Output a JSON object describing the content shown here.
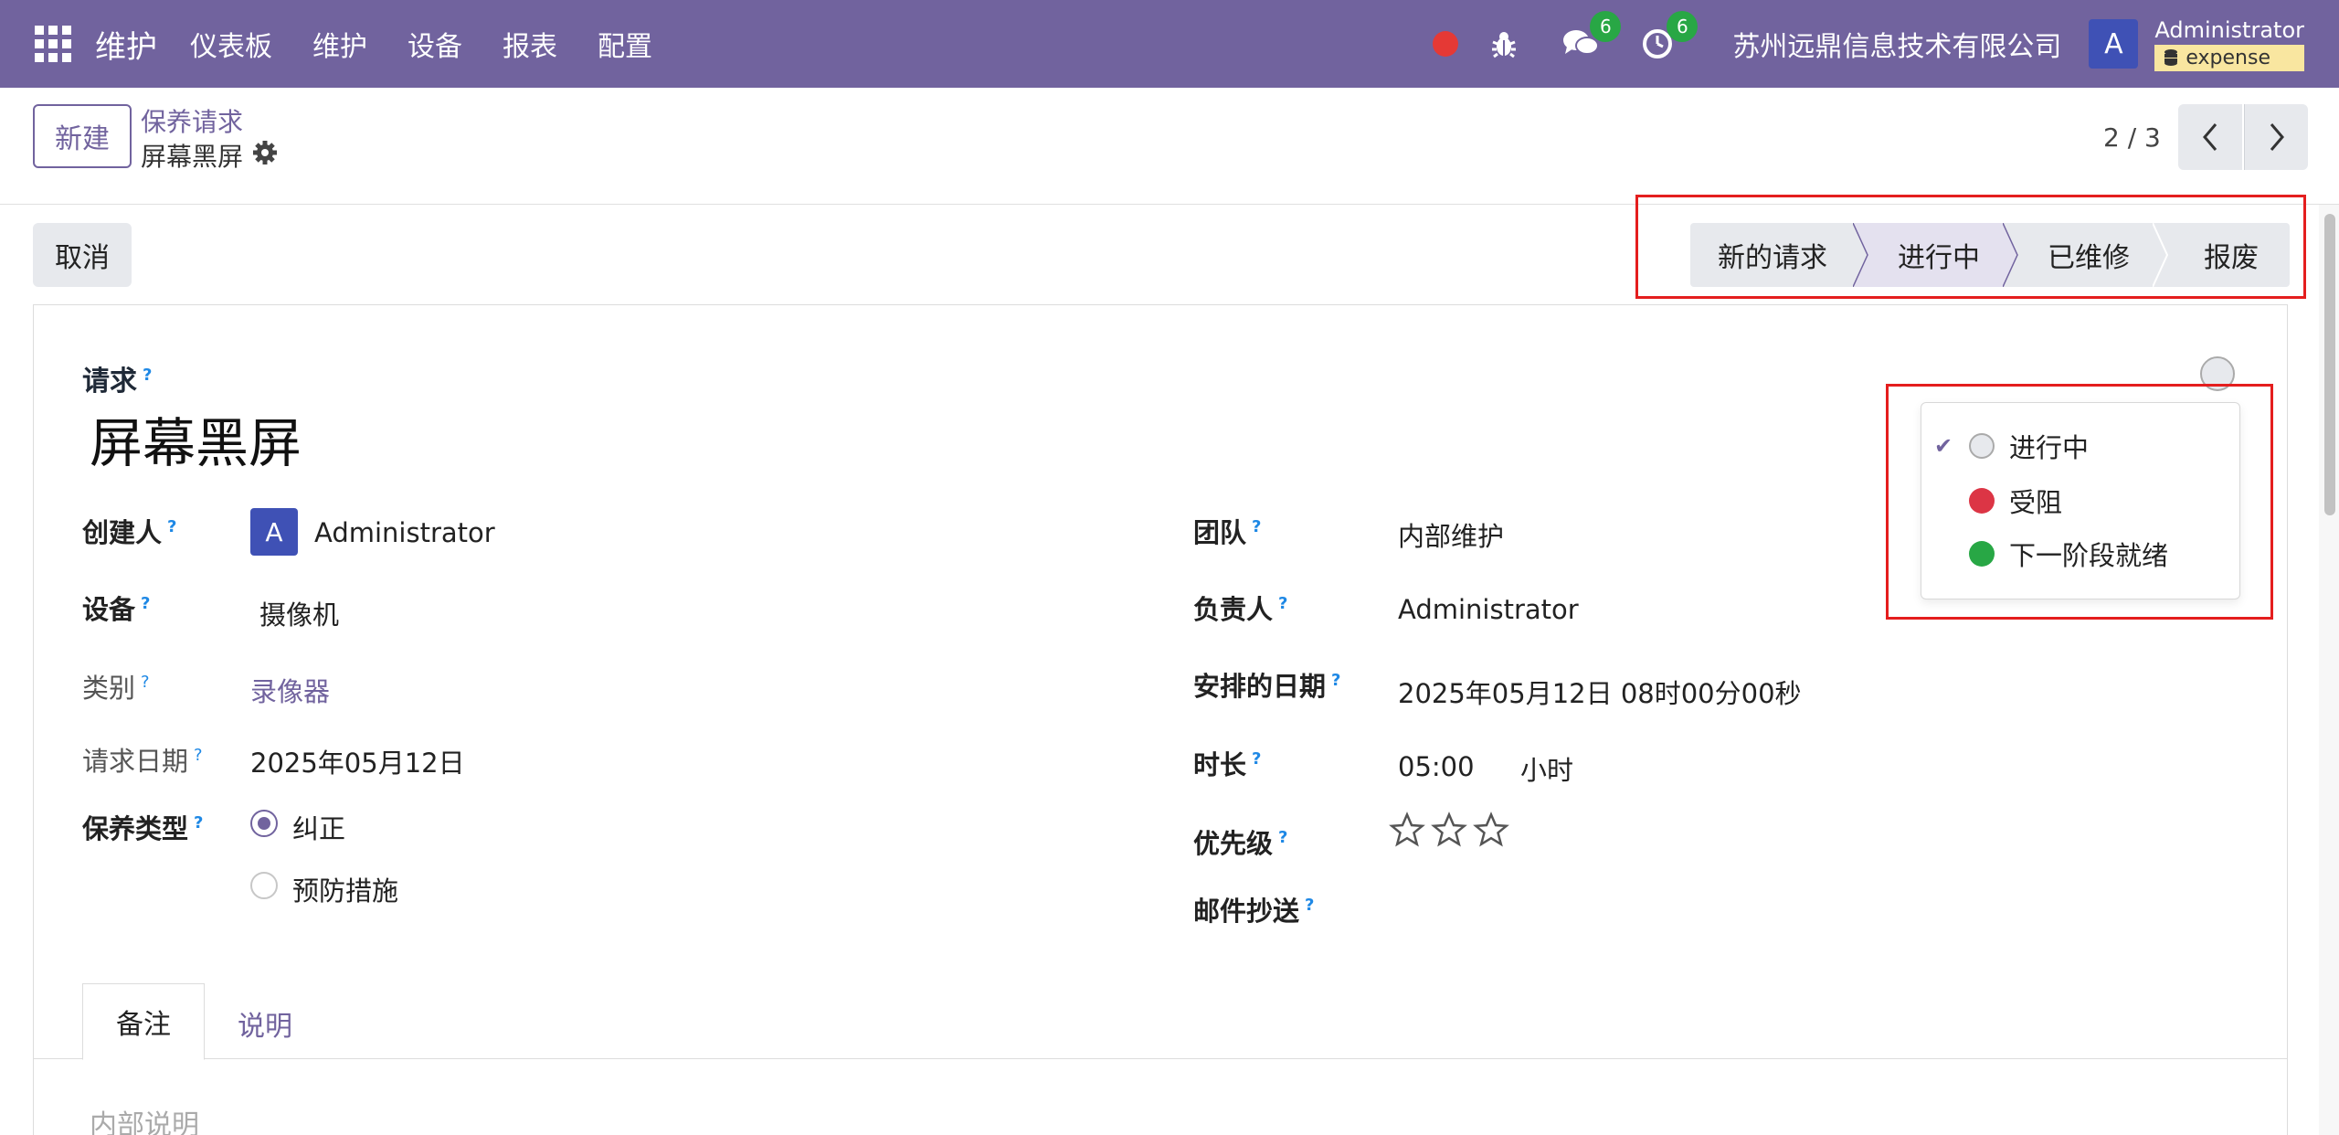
{
  "navbar": {
    "brand": "维护",
    "menu": [
      "仪表板",
      "维护",
      "设备",
      "报表",
      "配置"
    ],
    "chat_badge": "6",
    "activity_badge": "6",
    "company": "苏州远鼎信息技术有限公司",
    "avatar_letter": "A",
    "user_name": "Administrator",
    "db_name": "expense",
    "color": "#71639e"
  },
  "control": {
    "new_label": "新建",
    "breadcrumb_parent": "保养请求",
    "breadcrumb_current": "屏幕黑屏",
    "pager": "2 / 3"
  },
  "actions": {
    "cancel_label": "取消"
  },
  "stages": [
    "新的请求",
    "进行中",
    "已维修",
    "报废"
  ],
  "form": {
    "title_label": "请求",
    "title": "屏幕黑屏",
    "left": {
      "created_by_label": "创建人",
      "created_by_avatar": "A",
      "created_by": "Administrator",
      "equipment_label": "设备",
      "equipment": "摄像机",
      "category_label": "类别",
      "category": "录像器",
      "request_date_label": "请求日期",
      "request_date": "2025年05月12日",
      "maintenance_type_label": "保养类型",
      "maintenance_type_options": [
        "纠正",
        "预防措施"
      ],
      "maintenance_type_selected": "纠正"
    },
    "right": {
      "team_label": "团队",
      "team": "内部维护",
      "responsible_label": "负责人",
      "responsible": "Administrator",
      "scheduled_label": "安排的日期",
      "scheduled": "2025年05月12日 08时00分00秒",
      "duration_label": "时长",
      "duration": "05:00",
      "duration_unit": "小时",
      "priority_label": "优先级",
      "priority_stars": 0,
      "priority_max": 3,
      "email_cc_label": "邮件抄送"
    }
  },
  "kanban_state_dropdown": {
    "items": [
      {
        "label": "进行中",
        "color": "#e7e9ed",
        "checked": true
      },
      {
        "label": "受阻",
        "color": "#dc3545",
        "checked": false
      },
      {
        "label": "下一阶段就绪",
        "color": "#28a745",
        "checked": false
      }
    ]
  },
  "tabs": [
    "备注",
    "说明"
  ],
  "notes_placeholder": "内部说明"
}
